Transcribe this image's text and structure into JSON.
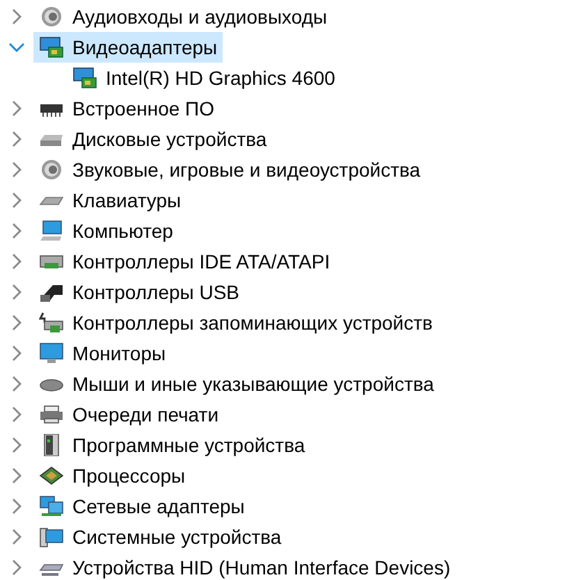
{
  "tree": [
    {
      "label": "Аудиовходы и аудиовыходы",
      "kind": "audio",
      "expanded": false,
      "selected": false
    },
    {
      "label": "Видеоадаптеры",
      "kind": "display",
      "expanded": true,
      "selected": true,
      "children": [
        {
          "label": "Intel(R) HD Graphics 4600",
          "kind": "display",
          "selected": false
        }
      ]
    },
    {
      "label": "Встроенное ПО",
      "kind": "firmware",
      "expanded": false,
      "selected": false
    },
    {
      "label": "Дисковые устройства",
      "kind": "disk",
      "expanded": false,
      "selected": false
    },
    {
      "label": "Звуковые, игровые и видеоустройства",
      "kind": "audio",
      "expanded": false,
      "selected": false
    },
    {
      "label": "Клавиатуры",
      "kind": "keyboard",
      "expanded": false,
      "selected": false
    },
    {
      "label": "Компьютер",
      "kind": "computer",
      "expanded": false,
      "selected": false
    },
    {
      "label": "Контроллеры IDE ATA/ATAPI",
      "kind": "ide",
      "expanded": false,
      "selected": false
    },
    {
      "label": "Контроллеры USB",
      "kind": "usb",
      "expanded": false,
      "selected": false
    },
    {
      "label": "Контроллеры запоминающих устройств",
      "kind": "storage",
      "expanded": false,
      "selected": false
    },
    {
      "label": "Мониторы",
      "kind": "monitor",
      "expanded": false,
      "selected": false
    },
    {
      "label": "Мыши и иные указывающие устройства",
      "kind": "mouse",
      "expanded": false,
      "selected": false
    },
    {
      "label": "Очереди печати",
      "kind": "printer",
      "expanded": false,
      "selected": false
    },
    {
      "label": "Программные устройства",
      "kind": "tower",
      "expanded": false,
      "selected": false
    },
    {
      "label": "Процессоры",
      "kind": "cpu",
      "expanded": false,
      "selected": false
    },
    {
      "label": "Сетевые адаптеры",
      "kind": "network",
      "expanded": false,
      "selected": false
    },
    {
      "label": "Системные устройства",
      "kind": "system",
      "expanded": false,
      "selected": false
    },
    {
      "label": "Устройства HID (Human Interface Devices)",
      "kind": "hid",
      "expanded": false,
      "selected": false
    }
  ]
}
